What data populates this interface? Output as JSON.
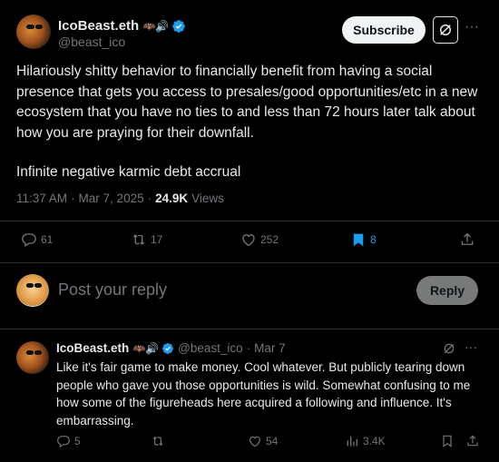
{
  "post": {
    "display_name": "IcoBeast.eth",
    "name_emojis": "🦇🔊",
    "handle": "@beast_ico",
    "subscribe_label": "Subscribe",
    "more_label": "···",
    "paragraphs": [
      "Hilariously shitty behavior to financially benefit from having a social presence that gets you access to presales/good opportunities/etc in a new ecosystem that you have no ties to and less than 72 hours later talk about how you are praying for their downfall.",
      "Infinite negative karmic debt accrual"
    ],
    "time": "11:37 AM",
    "separator": "·",
    "date": "Mar 7, 2025",
    "views_count": "24.9K",
    "views_label": "Views",
    "stats": {
      "replies": "61",
      "reposts": "17",
      "likes": "252",
      "bookmarks": "8"
    },
    "accent_color": "#1d9bf0"
  },
  "reply_box": {
    "placeholder": "Post your reply",
    "button_label": "Reply"
  },
  "reply": {
    "display_name": "IcoBeast.eth",
    "name_emojis": "🦇🔊",
    "handle": "@beast_ico",
    "separator": "·",
    "date": "Mar 7",
    "text": "Like it's fair game to make money. Cool whatever. But publicly tearing down people who gave you those opportunities is wild. Somewhat confusing to me how some of the figureheads here acquired a following and influence. It's embarrassing.",
    "more_label": "···",
    "stats": {
      "replies": "5",
      "likes": "54",
      "views": "3.4K"
    }
  }
}
